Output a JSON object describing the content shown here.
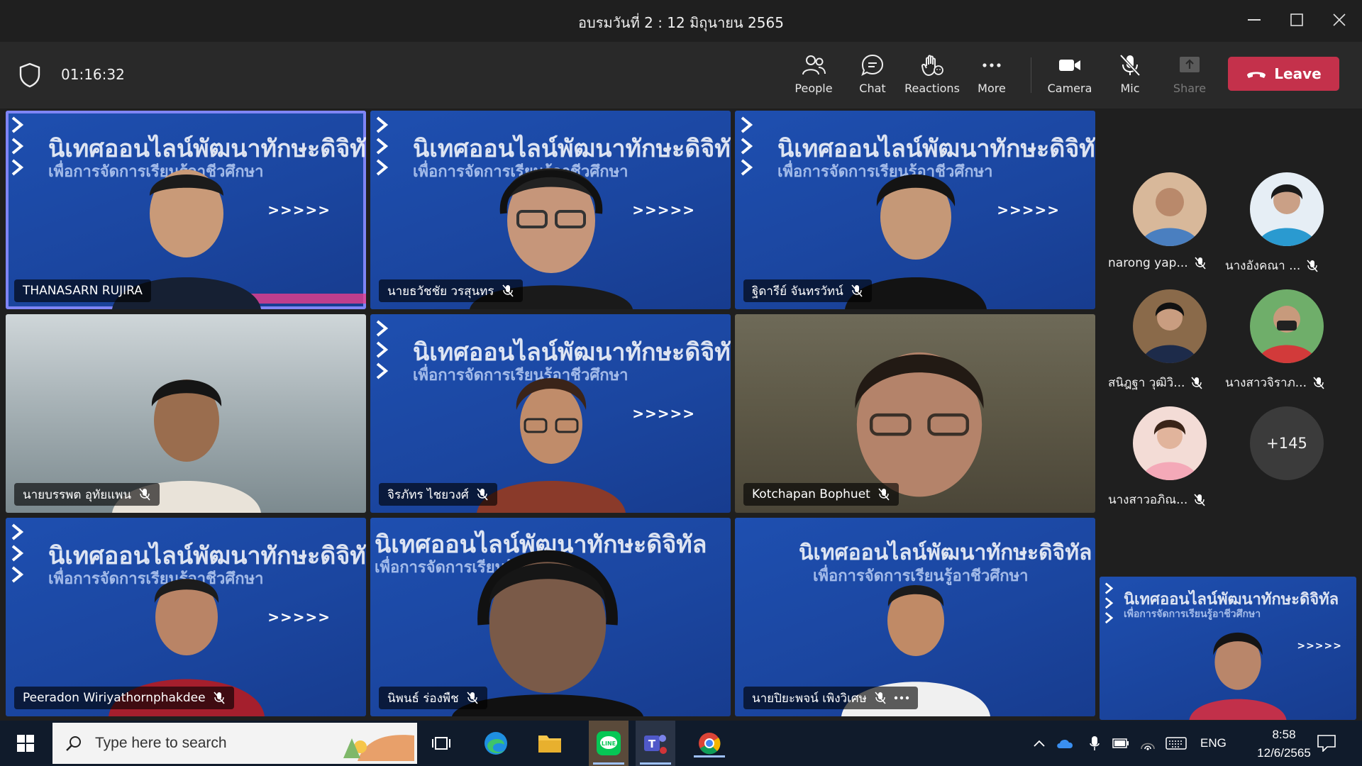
{
  "window": {
    "title": "อบรมวันที่ 2 : 12 มิถุนายน 2565"
  },
  "toolbar": {
    "timer": "01:16:32",
    "buttons": [
      {
        "label": "People",
        "icon": "people-icon"
      },
      {
        "label": "Chat",
        "icon": "chat-icon"
      },
      {
        "label": "Reactions",
        "icon": "reactions-icon"
      },
      {
        "label": "More",
        "icon": "more-icon"
      },
      {
        "label": "Camera",
        "icon": "camera-icon"
      },
      {
        "label": "Mic",
        "icon": "mic-off-icon"
      },
      {
        "label": "Share",
        "icon": "share-icon"
      }
    ],
    "leave_label": "Leave"
  },
  "tiles": [
    {
      "name": "THANASARN RUJIRA",
      "muted": false,
      "active": true
    },
    {
      "name": "นายธวัชชัย วรสุนทร",
      "muted": true
    },
    {
      "name": "ฐิดารีย์ จันทรวัทน์",
      "muted": true
    },
    {
      "name": "นายบรรพต อุทัยแพน",
      "muted": true
    },
    {
      "name": "จิรภัทร ไชยวงศ์",
      "muted": true
    },
    {
      "name": "Kotchapan Bophuet",
      "muted": true
    },
    {
      "name": "Peeradon Wiriyathornphakdee",
      "muted": true
    },
    {
      "name": "นิพนธ์ ร่องพืช",
      "muted": true
    },
    {
      "name": "นายปิยะพจน์ เพิงวิเศษ",
      "muted": true
    }
  ],
  "roster": [
    {
      "name": "narong yap..."
    },
    {
      "name": "นางอังคณา ..."
    },
    {
      "name": "สนิฎฐา วุฒิวิ..."
    },
    {
      "name": "นางสาวจิราภ..."
    },
    {
      "name": "นางสาวอภิณ..."
    }
  ],
  "roster_more": "+145",
  "banner": {
    "line1": "นิเทศออนไลน์พัฒนาทักษะดิจิทัล",
    "line2": "เพื่อการจัดการเรียนรู้อาชีวศึกษา",
    "arrows": ">>>>>"
  },
  "taskbar": {
    "search_placeholder": "Type here to search",
    "language": "ENG",
    "time": "8:58",
    "date": "12/6/2565"
  },
  "colors": {
    "leave": "#c4314b",
    "active_outline": "#7f85f5",
    "tile_blue": "#1b46a0"
  }
}
